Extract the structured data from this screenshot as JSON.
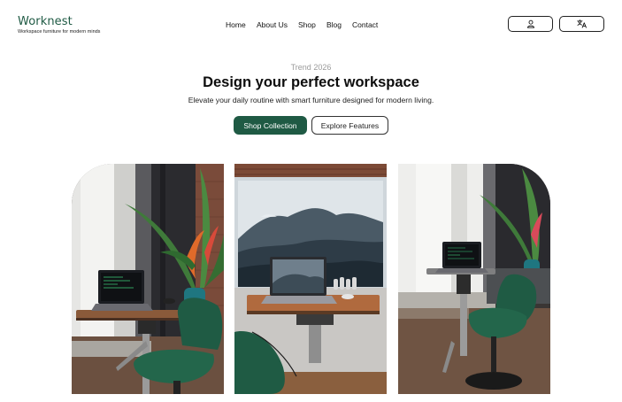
{
  "brand": {
    "name": "Worknest",
    "tagline": "Workspace furniture for modern minds",
    "accent_color": "#1f5a44"
  },
  "nav": {
    "items": [
      {
        "label": "Home"
      },
      {
        "label": "About Us"
      },
      {
        "label": "Shop"
      },
      {
        "label": "Blog"
      },
      {
        "label": "Contact"
      }
    ]
  },
  "header_actions": {
    "account_icon": "user-icon",
    "language_icon": "translate-icon"
  },
  "hero": {
    "eyebrow": "Trend 2026",
    "title": "Design your perfect workspace",
    "subtitle": "Elevate your daily routine with smart furniture designed for modern living.",
    "primary_cta": "Shop Collection",
    "secondary_cta": "Explore Features"
  },
  "gallery": {
    "images": [
      {
        "subject": "standing desk with laptop, plant and green chair by window"
      },
      {
        "subject": "standing desk with laptop in front of mountain painting on brick wall"
      },
      {
        "subject": "standing desk with laptop, green chair and plant by window"
      }
    ]
  }
}
